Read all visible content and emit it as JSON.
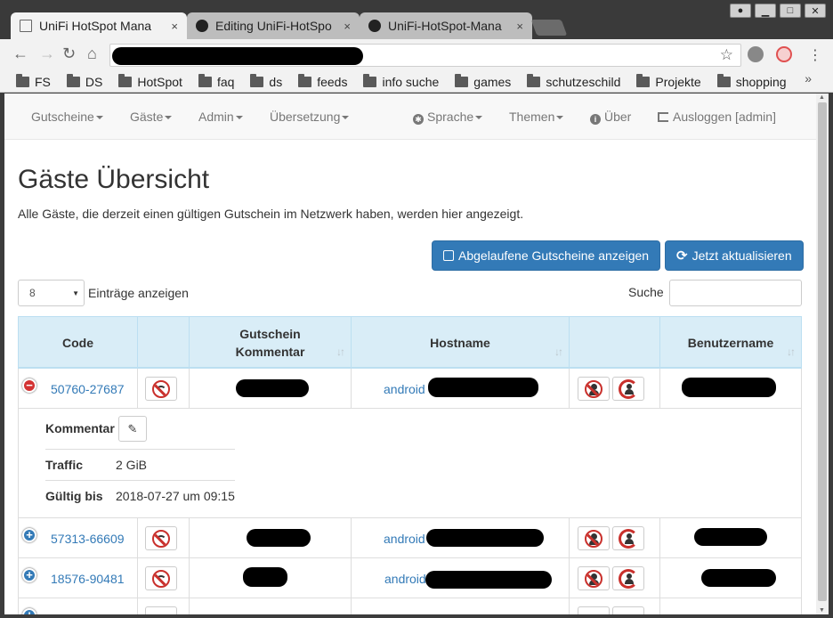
{
  "browser": {
    "tabs": [
      {
        "title": "UniFi HotSpot Mana",
        "close": "×",
        "active": true
      },
      {
        "title": "Editing UniFi-HotSpo",
        "close": "×",
        "active": false
      },
      {
        "title": "UniFi-HotSpot-Mana",
        "close": "×",
        "active": false
      }
    ],
    "window_controls": [
      "person-icon",
      "minimize-icon",
      "maximize-icon",
      "close-icon"
    ],
    "bookmarks": [
      "FS",
      "DS",
      "HotSpot",
      "faq",
      "ds",
      "feeds",
      "info suche",
      "games",
      "schutzeschild",
      "Projekte",
      "shopping"
    ],
    "bookmarks_more": "»"
  },
  "navbar": {
    "left": [
      "Gutscheine",
      "Gäste",
      "Admin",
      "Übersetzung"
    ],
    "sprache": "Sprache",
    "themen": "Themen",
    "ueber": "Über",
    "logout": "Ausloggen [admin]"
  },
  "page": {
    "title": "Gäste Übersicht",
    "lead": "Alle Gäste, die derzeit einen gültigen Gutschein im Netzwerk haben, werden hier angezeigt.",
    "btn_expired": "Abgelaufene Gutscheine anzeigen",
    "btn_refresh": "Jetzt aktualisieren",
    "page_length": "8",
    "length_label": "Einträge anzeigen",
    "search_label": "Suche"
  },
  "table": {
    "headers": {
      "code": "Code",
      "comment_1": "Gutschein",
      "comment_2": "Kommentar",
      "hostname": "Hostname",
      "username": "Benutzername"
    },
    "rows": [
      {
        "code": "50760-27687",
        "host": "android",
        "expanded": true
      },
      {
        "code": "57313-66609",
        "host": "android",
        "expanded": false
      },
      {
        "code": "18576-90481",
        "host": "android",
        "expanded": false
      }
    ],
    "detail": {
      "comment_label": "Kommentar",
      "traffic_label": "Traffic",
      "traffic_value": "2 GiB",
      "valid_label": "Gültig bis",
      "valid_value": "2018-07-27 um 09:15"
    }
  },
  "colors": {
    "primary": "#337ab7",
    "header_bg": "#d9edf7",
    "danger": "#c9302c",
    "navbar_bg": "#f8f8f8"
  }
}
